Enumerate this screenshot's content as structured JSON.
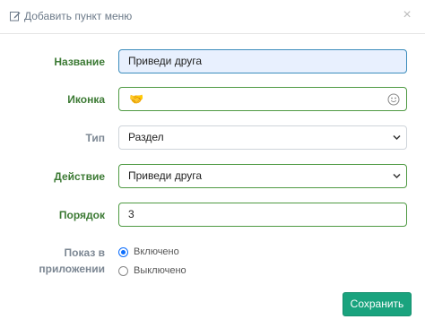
{
  "header": {
    "title": "Добавить пункт меню",
    "close_symbol": "×"
  },
  "form": {
    "name": {
      "label": "Название",
      "value": "Приведи друга"
    },
    "icon": {
      "label": "Иконка",
      "value": "🤝",
      "picker_icon": "smiley-icon"
    },
    "type": {
      "label": "Тип",
      "value": "Раздел"
    },
    "action": {
      "label": "Действие",
      "value": "Приведи друга"
    },
    "order": {
      "label": "Порядок",
      "value": "3"
    },
    "visibility": {
      "label_line1": "Показ в",
      "label_line2": "приложении",
      "options": [
        {
          "label": "Включено",
          "checked": true
        },
        {
          "label": "Выключено",
          "checked": false
        }
      ]
    }
  },
  "footer": {
    "save_label": "Сохранить"
  },
  "colors": {
    "accent_green": "#1aa37e",
    "label_green": "#3c7a34",
    "label_gray": "#7c8793",
    "radio_blue": "#0d6efd",
    "name_field_bg": "#e8f0fe"
  }
}
